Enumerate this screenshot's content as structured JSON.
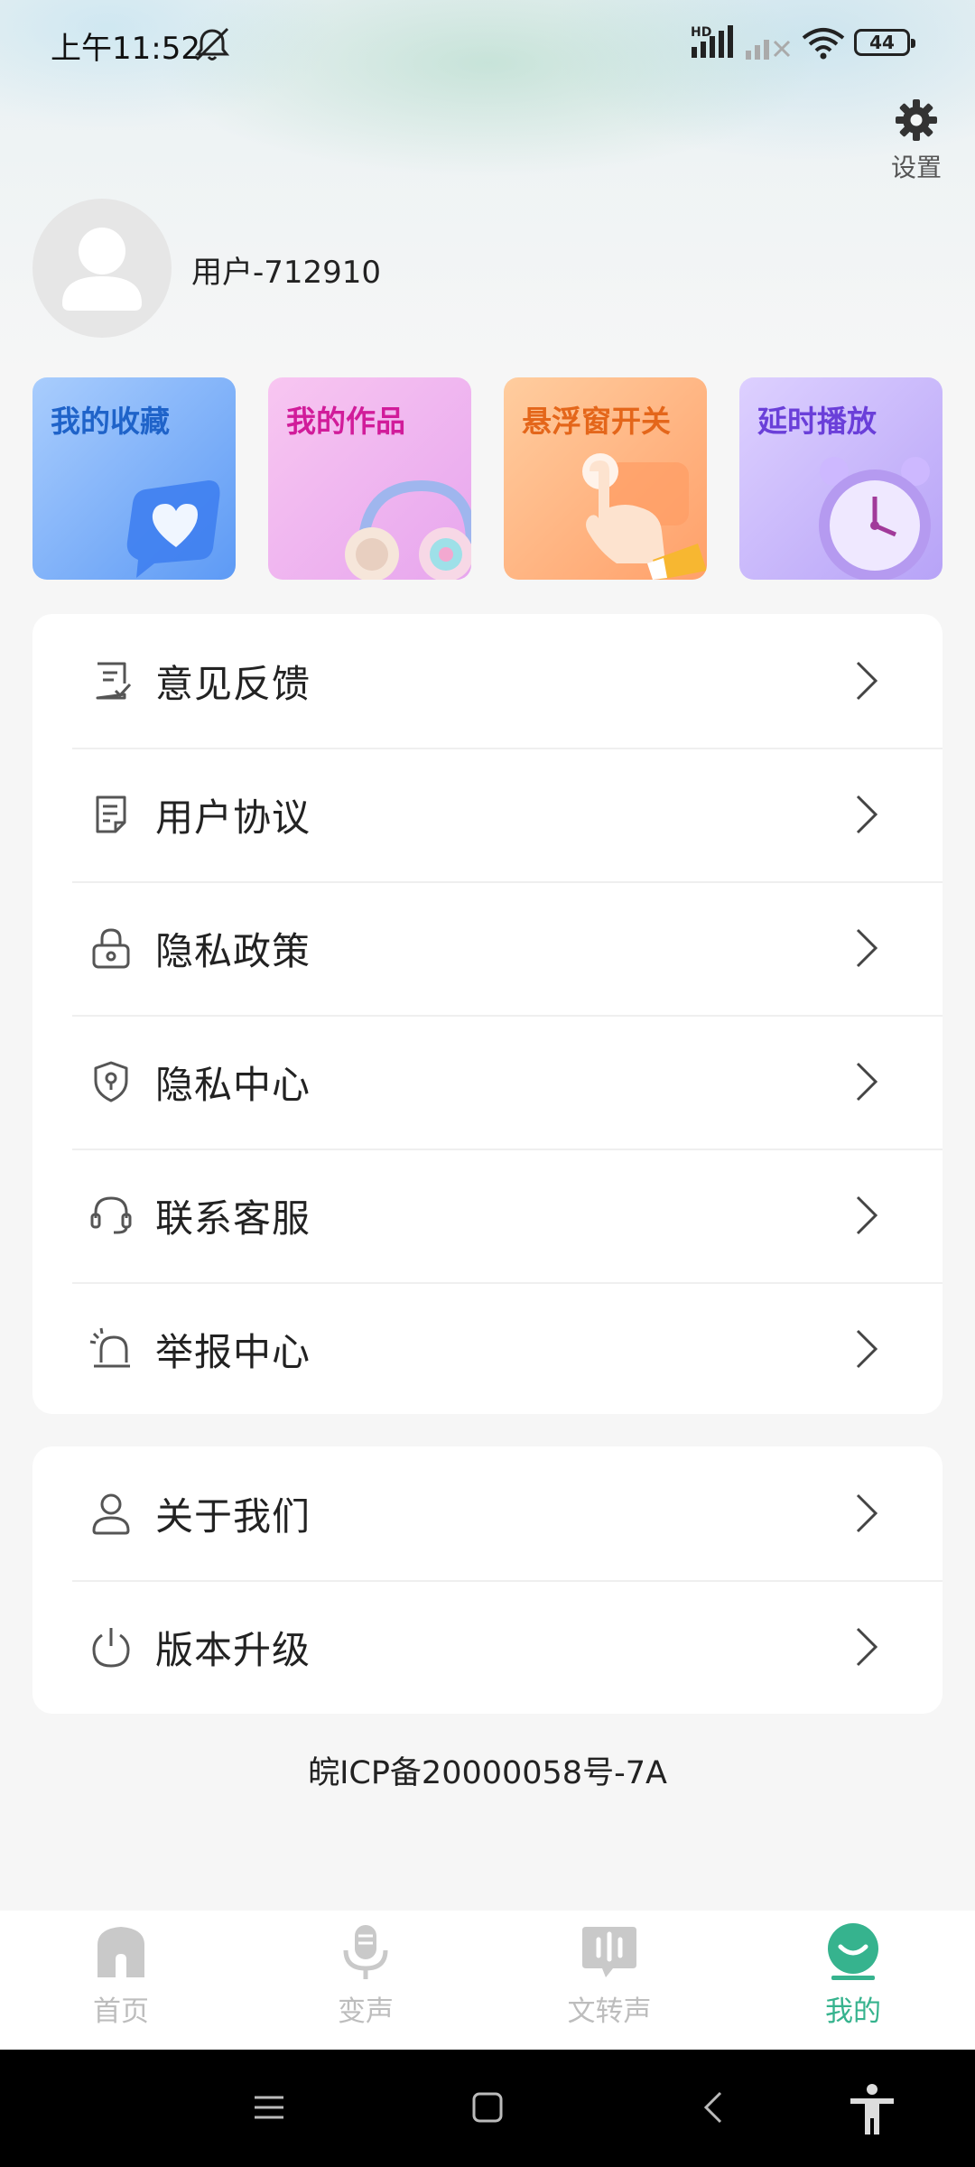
{
  "status_bar": {
    "time": "上午11:52",
    "hd": "HD",
    "battery": "44"
  },
  "settings": {
    "label": "设置"
  },
  "user": {
    "name": "用户-712910"
  },
  "cards": [
    {
      "label": "我的收藏"
    },
    {
      "label": "我的作品"
    },
    {
      "label": "悬浮窗开关"
    },
    {
      "label": "延时播放"
    }
  ],
  "menu_group_1": [
    {
      "label": "意见反馈",
      "icon": "feedback-icon"
    },
    {
      "label": "用户协议",
      "icon": "document-icon"
    },
    {
      "label": "隐私政策",
      "icon": "lock-icon"
    },
    {
      "label": "隐私中心",
      "icon": "shield-icon"
    },
    {
      "label": "联系客服",
      "icon": "headset-icon"
    },
    {
      "label": "举报中心",
      "icon": "alarm-icon"
    }
  ],
  "menu_group_2": [
    {
      "label": "关于我们",
      "icon": "person-icon"
    },
    {
      "label": "版本升级",
      "icon": "power-icon"
    }
  ],
  "icp": "皖ICP备20000058号-7A",
  "tabs": [
    {
      "label": "首页",
      "icon": "home-icon"
    },
    {
      "label": "变声",
      "icon": "microphone-icon"
    },
    {
      "label": "文转声",
      "icon": "text-to-speech-icon"
    },
    {
      "label": "我的",
      "icon": "profile-icon",
      "active": true
    }
  ],
  "colors": {
    "accent": "#36b38e",
    "inactive_tab": "#bdbdbd"
  }
}
